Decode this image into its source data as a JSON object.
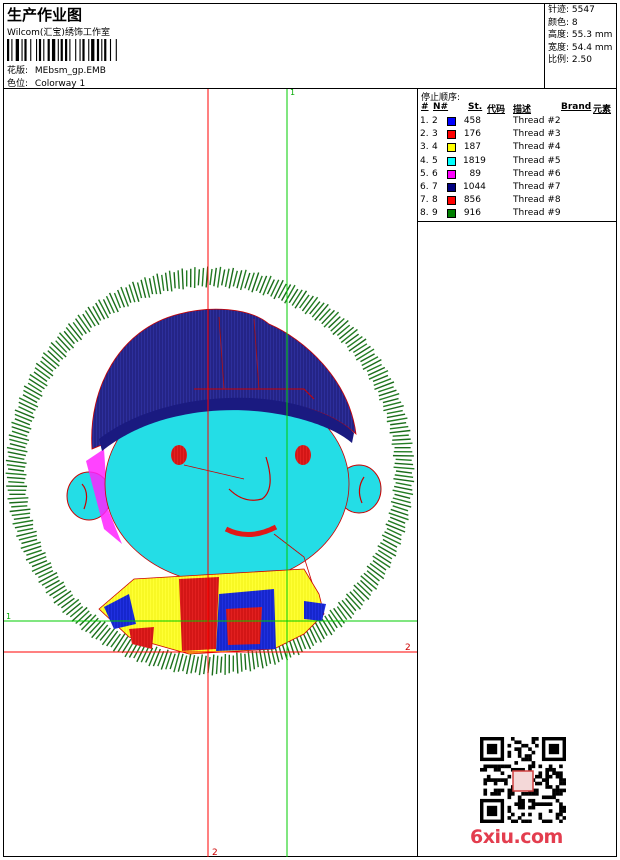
{
  "header": {
    "title": "生产作业图",
    "company": "Wilcom(汇宝)绣饰工作室",
    "design_label": "花版:",
    "design_value": "MEbsm_gp.EMB",
    "colorway_label": "色位:",
    "colorway_value": "Colorway 1"
  },
  "stats": {
    "stitches_label": "针迹:",
    "stitches_value": "5547",
    "colors_label": "颜色:",
    "colors_value": "8",
    "height_label": "高度:",
    "height_value": "55.3 mm",
    "width_label": "宽度:",
    "width_value": "54.4 mm",
    "scale_label": "比例:",
    "scale_value": "2.50"
  },
  "legend": {
    "title": "停止顺序:",
    "headers": {
      "num": "#",
      "needle": "N#",
      "stitches": "St.",
      "code": "代码",
      "desc": "描述",
      "brand": "Brand",
      "element": "元素"
    },
    "rows": [
      {
        "num": "1.",
        "needle": "2",
        "color": "#0000ff",
        "stitches": "458",
        "desc": "Thread #2"
      },
      {
        "num": "2.",
        "needle": "3",
        "color": "#ff0000",
        "stitches": "176",
        "desc": "Thread #3"
      },
      {
        "num": "3.",
        "needle": "4",
        "color": "#ffff00",
        "stitches": "187",
        "desc": "Thread #4"
      },
      {
        "num": "4.",
        "needle": "5",
        "color": "#00ffff",
        "stitches": "1819",
        "desc": "Thread #5"
      },
      {
        "num": "5.",
        "needle": "6",
        "color": "#ff00ff",
        "stitches": "89",
        "desc": "Thread #6"
      },
      {
        "num": "6.",
        "needle": "7",
        "color": "#000080",
        "stitches": "1044",
        "desc": "Thread #7"
      },
      {
        "num": "7.",
        "needle": "8",
        "color": "#ff0000",
        "stitches": "856",
        "desc": "Thread #8"
      },
      {
        "num": "8.",
        "needle": "9",
        "color": "#008000",
        "stitches": "916",
        "desc": "Thread #9"
      }
    ]
  },
  "guides": {
    "v_green": "1",
    "h_green": "1",
    "h_red": "2",
    "v_red": "2"
  },
  "watermark": "6xiu.com",
  "colors": {
    "ring": "#1f7a1f",
    "face": "#22e0e8",
    "hat": "#2a2a9a",
    "red": "#e01818",
    "yellow": "#ffff22",
    "blue": "#1a2ad8",
    "magenta": "#ff00ff",
    "guide_red": "#ff0000",
    "guide_green": "#00cc00"
  }
}
